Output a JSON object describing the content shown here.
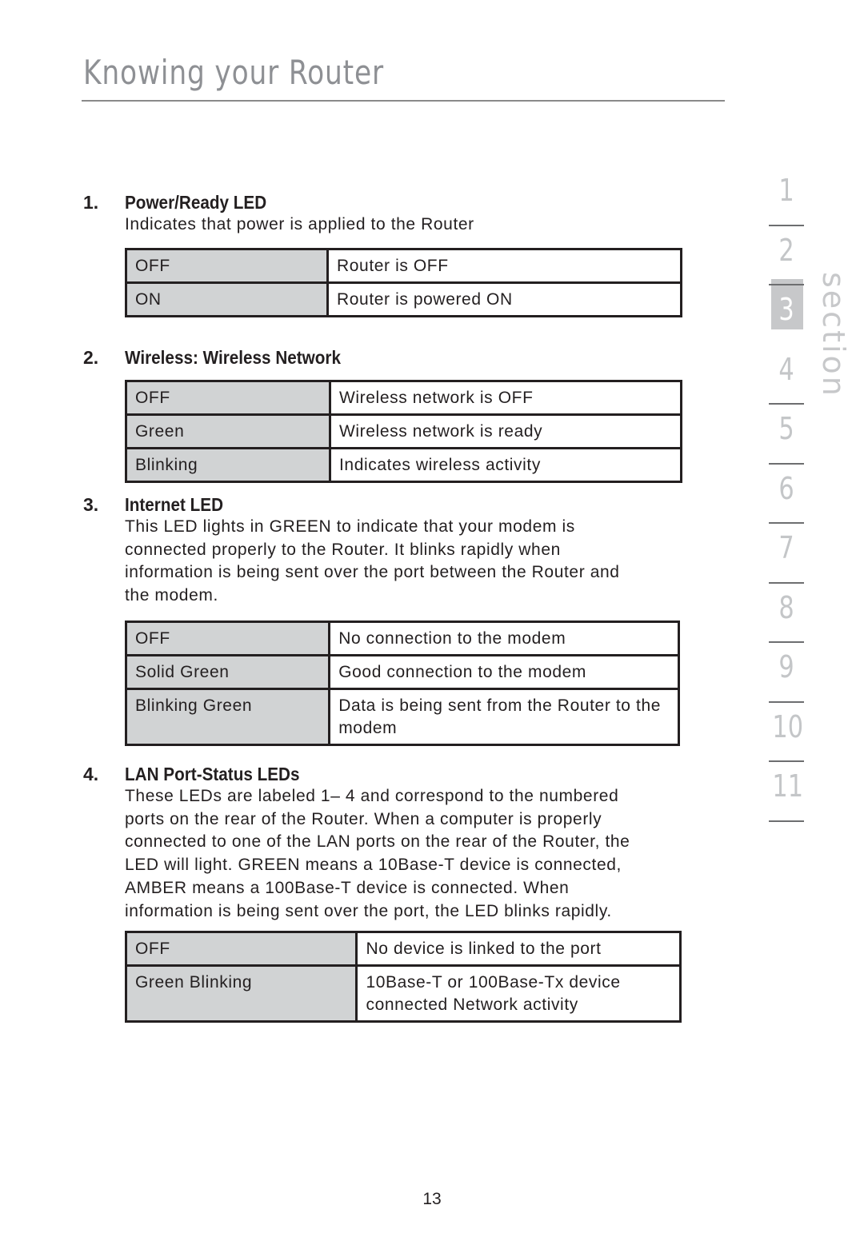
{
  "header": {
    "title": "Knowing your Router"
  },
  "sections": [
    {
      "number": "1.",
      "title": "Power/Ready LED",
      "description": [
        "Indicates that power is applied to the Router"
      ],
      "table": [
        {
          "state": "OFF",
          "meaning": "Router is OFF"
        },
        {
          "state": "ON",
          "meaning": "Router is powered ON"
        }
      ]
    },
    {
      "number": "2.",
      "title": "Wireless: Wireless Network",
      "description": [],
      "table": [
        {
          "state": "OFF",
          "meaning": "Wireless network is OFF"
        },
        {
          "state": "Green",
          "meaning": "Wireless network is ready"
        },
        {
          "state": "Blinking",
          "meaning": "Indicates wireless activity"
        }
      ]
    },
    {
      "number": "3.",
      "title": "Internet LED",
      "description": [
        "This LED lights in GREEN to indicate that your modem is",
        "connected properly to the Router. It blinks rapidly when",
        "information is being sent over the port between the Router and",
        "the modem."
      ],
      "table": [
        {
          "state": "OFF",
          "meaning": "No connection to the modem"
        },
        {
          "state": "Solid Green",
          "meaning": "Good connection to the modem"
        },
        {
          "state": "Blinking Green",
          "meaning": "Data is being sent from the Router to the modem"
        }
      ]
    },
    {
      "number": "4.",
      "title": "LAN Port-Status LEDs",
      "description": [
        "These LEDs are labeled 1– 4 and correspond to the numbered",
        "ports on the rear of the Router. When a computer is properly",
        "connected to one of the LAN ports on the rear of the Router, the",
        "LED will light. GREEN means a 10Base-T device is connected,",
        "AMBER means a 100Base-T device is connected. When",
        "information is being sent over the port, the LED blinks rapidly."
      ],
      "table": [
        {
          "state": "OFF",
          "meaning": "No device is linked to the port"
        },
        {
          "state": "Green Blinking",
          "meaning": "10Base-T or 100Base-Tx device connected Network activity"
        }
      ]
    }
  ],
  "section_nav": {
    "label": "section",
    "items": [
      "1",
      "2",
      "3",
      "4",
      "5",
      "6",
      "7",
      "8",
      "9",
      "10",
      "11"
    ],
    "active": "3"
  },
  "footer": {
    "page_number": "13"
  }
}
